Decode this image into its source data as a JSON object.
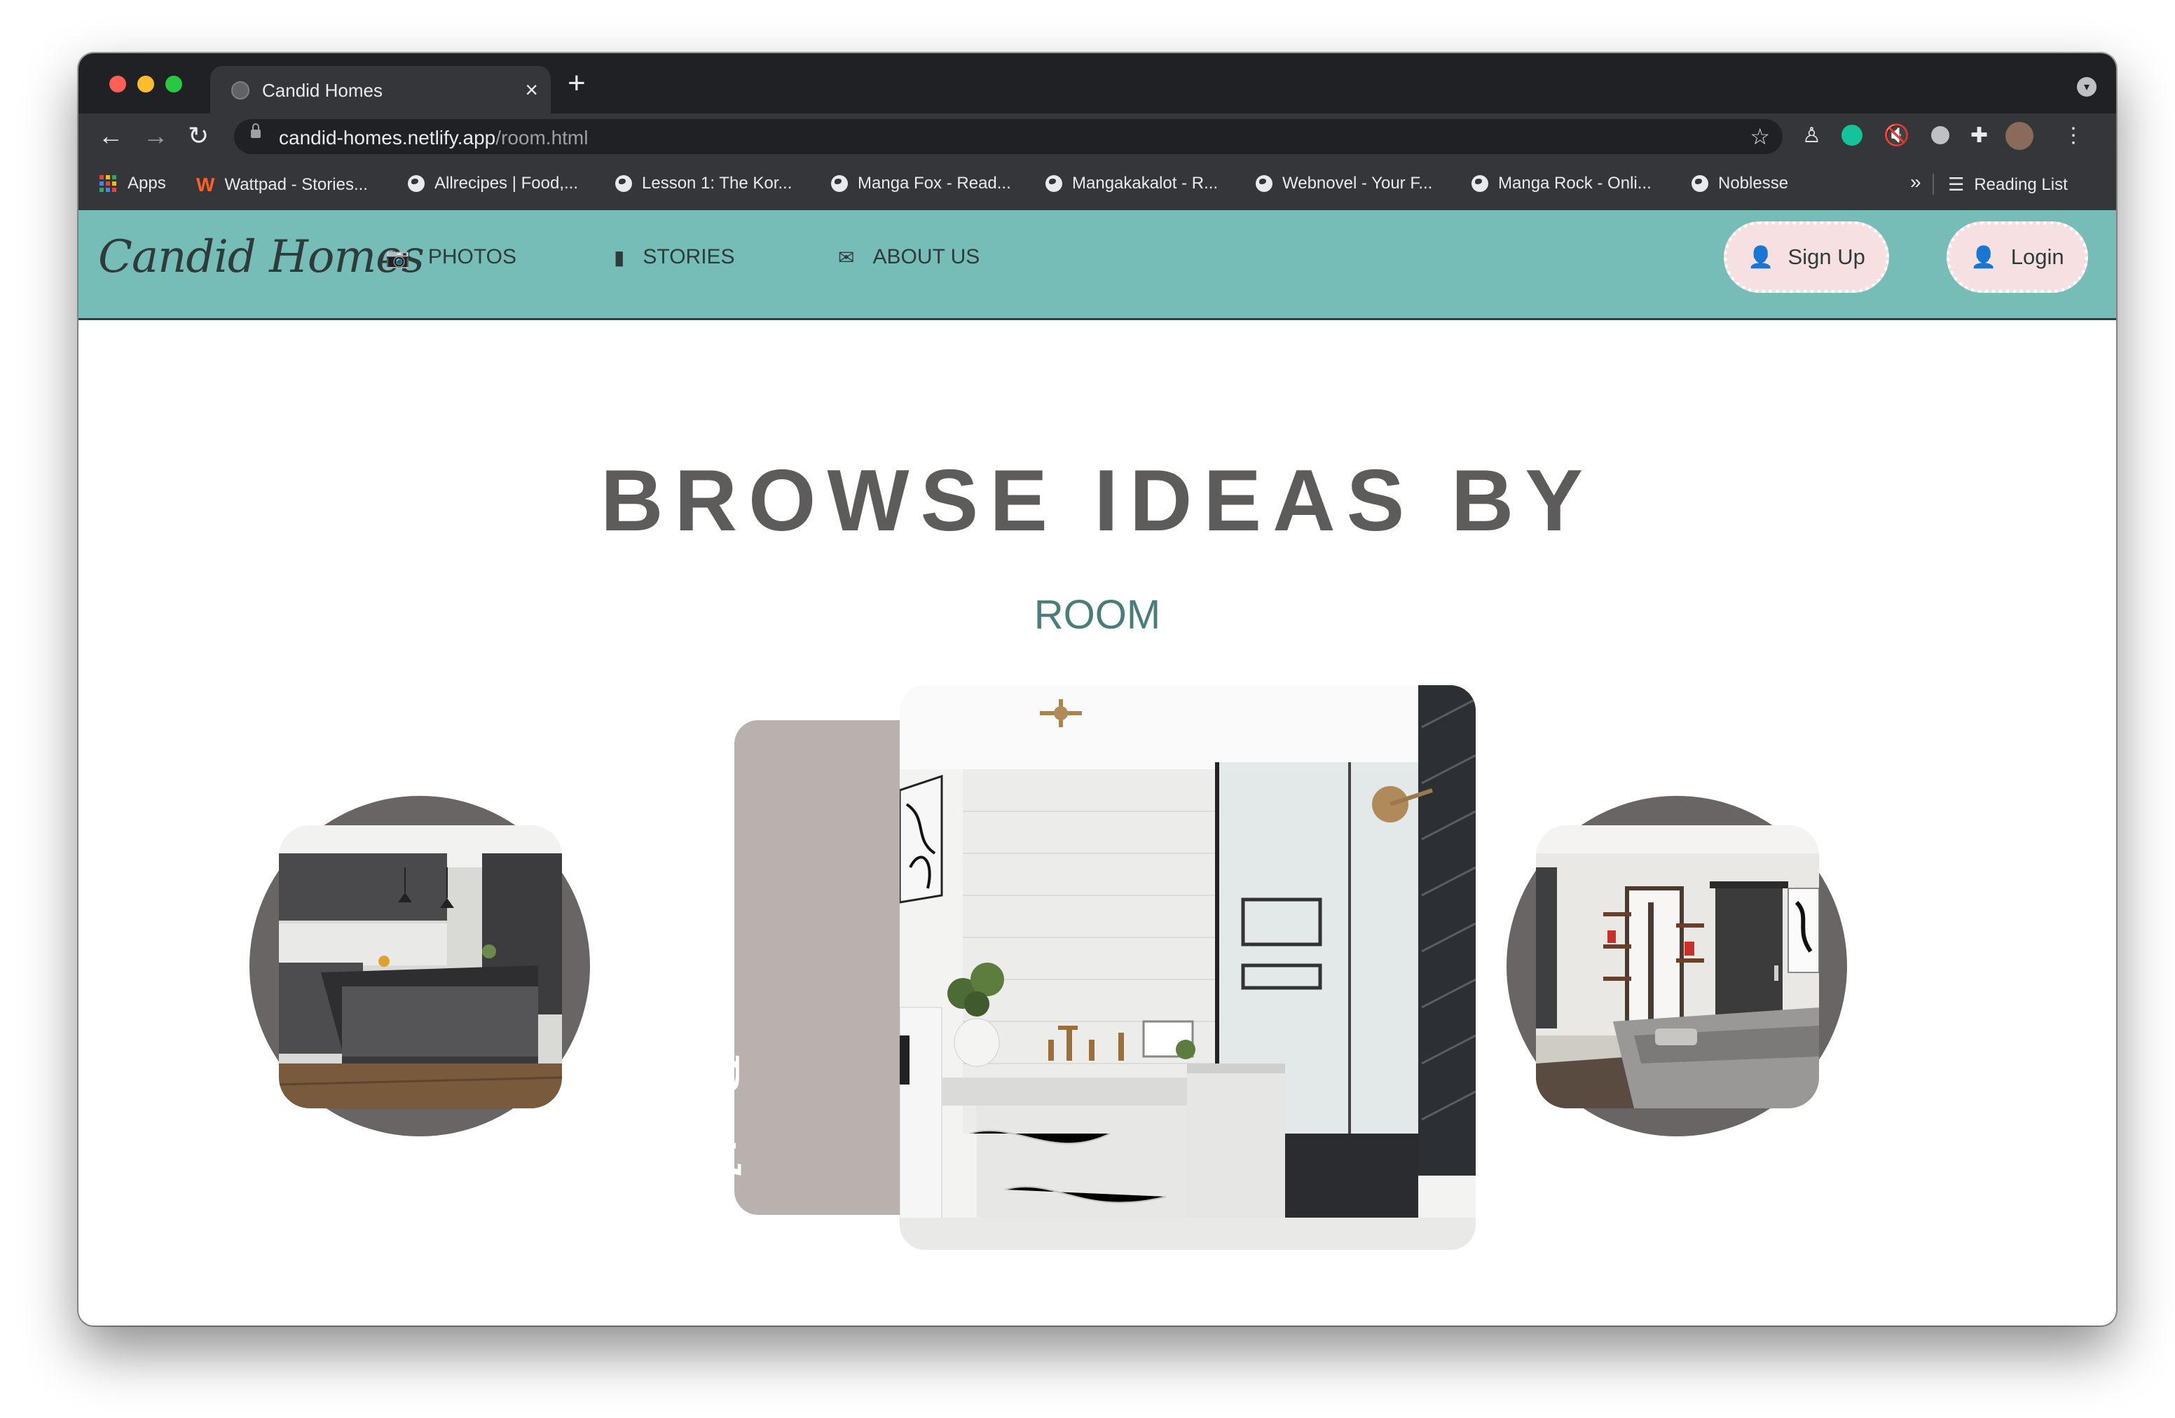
{
  "browser": {
    "tab_title": "Candid Homes",
    "tab_close": "×",
    "new_tab": "+",
    "url_host": "candid-homes.netlify.app",
    "url_path": "/room.html",
    "bookmarks": [
      {
        "label": "Apps",
        "icon": "apps-grid-icon"
      },
      {
        "label": "Wattpad - Stories...",
        "icon": "wattpad-icon"
      },
      {
        "label": "Allrecipes | Food,...",
        "icon": "globe-icon"
      },
      {
        "label": "Lesson 1: The Kor...",
        "icon": "globe-icon"
      },
      {
        "label": "Manga Fox - Read...",
        "icon": "globe-icon"
      },
      {
        "label": "Mangakakalot - R...",
        "icon": "globe-icon"
      },
      {
        "label": "Webnovel - Your F...",
        "icon": "globe-icon"
      },
      {
        "label": "Manga Rock - Onli...",
        "icon": "globe-icon"
      },
      {
        "label": "Noblesse",
        "icon": "globe-icon"
      }
    ],
    "bookmarks_overflow": "»",
    "reading_list": "Reading List"
  },
  "site": {
    "logo": "Candid Homes",
    "nav": [
      {
        "label": "PHOTOS",
        "icon": "camera-icon"
      },
      {
        "label": "STORIES",
        "icon": "book-icon"
      },
      {
        "label": "ABOUT US",
        "icon": "envelope-icon"
      }
    ],
    "signup_label": "Sign Up",
    "login_label": "Login"
  },
  "content": {
    "heading": "BROWSE IDEAS BY",
    "subheading": "ROOM",
    "carousel": {
      "left_image": "kitchen",
      "center_label": "Bath",
      "right_image": "bedroom"
    }
  },
  "colors": {
    "header_bg": "#77bdb7",
    "button_bg": "#f7e0e2",
    "heading": "#5e5b5b",
    "subheading": "#4a7d79",
    "circle": "#6a6565",
    "side_tab": "#b8b1ae"
  }
}
